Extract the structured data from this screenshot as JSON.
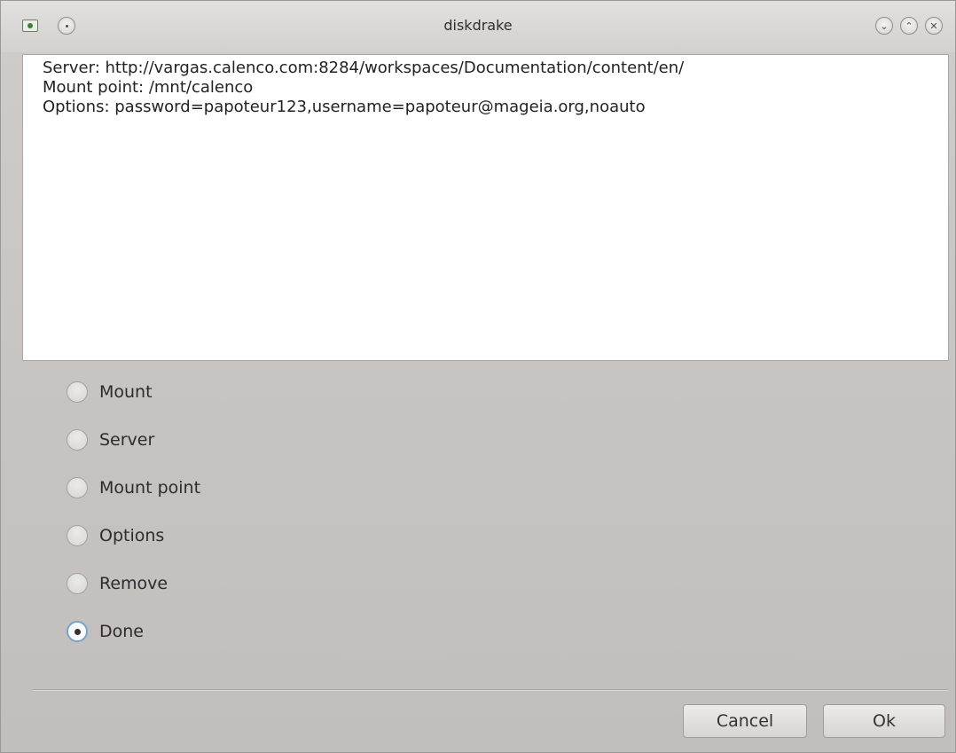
{
  "window": {
    "title": "diskdrake"
  },
  "titlebar": {
    "icons": [
      "app-icon",
      "menu-dot-icon",
      "minimize-icon",
      "maximize-icon",
      "close-icon"
    ],
    "minimize_glyph": "⌄",
    "maximize_glyph": "⌃",
    "close_glyph": "✕"
  },
  "info": {
    "lines": [
      "Server: http://vargas.calenco.com:8284/workspaces/Documentation/content/en/",
      "Mount point: /mnt/calenco",
      "Options: password=papoteur123,username=papoteur@mageia.org,noauto"
    ]
  },
  "options": {
    "items": [
      {
        "label": "Mount",
        "checked": false
      },
      {
        "label": "Server",
        "checked": false
      },
      {
        "label": "Mount point",
        "checked": false
      },
      {
        "label": "Options",
        "checked": false
      },
      {
        "label": "Remove",
        "checked": false
      },
      {
        "label": "Done",
        "checked": true
      }
    ]
  },
  "buttons": {
    "cancel_label": "Cancel",
    "ok_label": "Ok"
  },
  "colors": {
    "accent": "#6fa4d6",
    "window_bg": "#c7c4c1"
  }
}
